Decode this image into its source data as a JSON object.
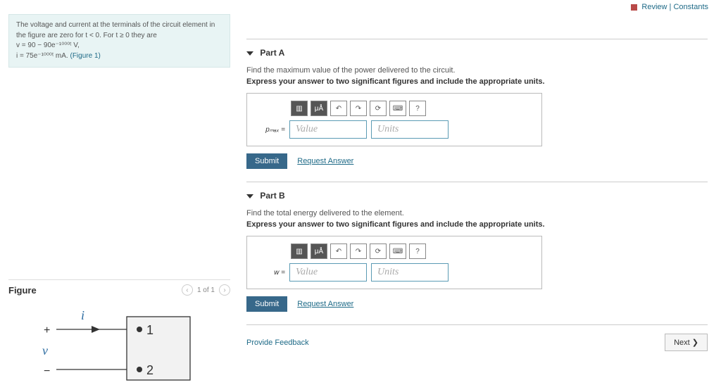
{
  "header": {
    "review": "Review",
    "constants": "Constants"
  },
  "problem": {
    "line1": "The voltage and current at the terminals of the circuit element in the figure are zero for t < 0. For t ≥ 0 they are",
    "eq1": "v = 90 − 90e⁻¹⁰⁰⁰ᵗ V,",
    "eq2": "i = 75e⁻¹⁰⁰⁰ᵗ mA.",
    "figure_link": "(Figure 1)"
  },
  "figure": {
    "title": "Figure",
    "pager": "1 of 1",
    "labels": {
      "i": "i",
      "v": "v",
      "plus": "+",
      "minus": "−",
      "t1": "1",
      "t2": "2"
    }
  },
  "parts": [
    {
      "label": "Part A",
      "q": "Find the maximum value of the power delivered to the circuit.",
      "hint": "Express your answer to two significant figures and include the appropriate units.",
      "var": "pₘₐₓ =",
      "value_ph": "Value",
      "units_ph": "Units",
      "submit": "Submit",
      "request": "Request Answer"
    },
    {
      "label": "Part B",
      "q": "Find the total energy delivered to the element.",
      "hint": "Express your answer to two significant figures and include the appropriate units.",
      "var": "w =",
      "value_ph": "Value",
      "units_ph": "Units",
      "submit": "Submit",
      "request": "Request Answer"
    }
  ],
  "footer": {
    "feedback": "Provide Feedback",
    "next": "Next ❯"
  },
  "toolbar_icons": [
    "fraction-icon",
    "micro-a-icon",
    "undo-icon",
    "redo-icon",
    "reset-icon",
    "keyboard-icon",
    "help-icon"
  ],
  "toolbar_glyphs": [
    "▥",
    "μÅ",
    "↶",
    "↷",
    "⟳",
    "⌨",
    "?"
  ]
}
